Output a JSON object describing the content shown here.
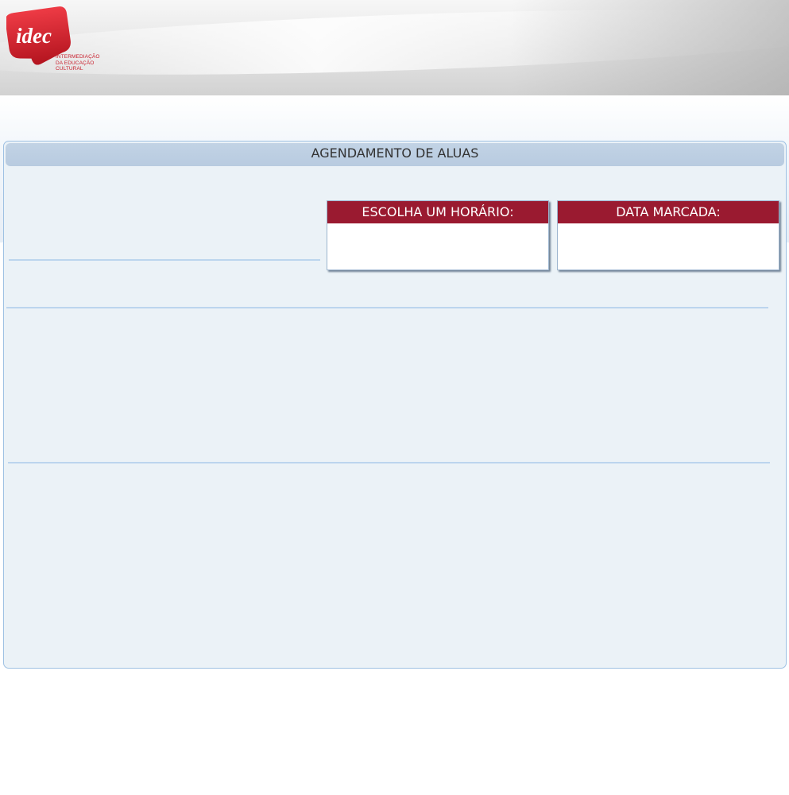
{
  "logo": {
    "word": "idec",
    "tagline": "INTERMEDIAÇÃO\nDA EDUCAÇÃO\nCULTURAL",
    "brand_color": "#c8202e"
  },
  "panel": {
    "title": "AGENDAMENTO DE ALUAS"
  },
  "horario_box": {
    "label": "ESCOLHA UM HORÁRIO:",
    "value": ""
  },
  "data_box": {
    "label": "DATA MARCADA:",
    "value": ""
  },
  "colors": {
    "accent": "#9a1a30",
    "panel_bg": "#ebf2f7",
    "panel_border": "#9ec1e3",
    "title_bar": "#b8cbe0"
  }
}
